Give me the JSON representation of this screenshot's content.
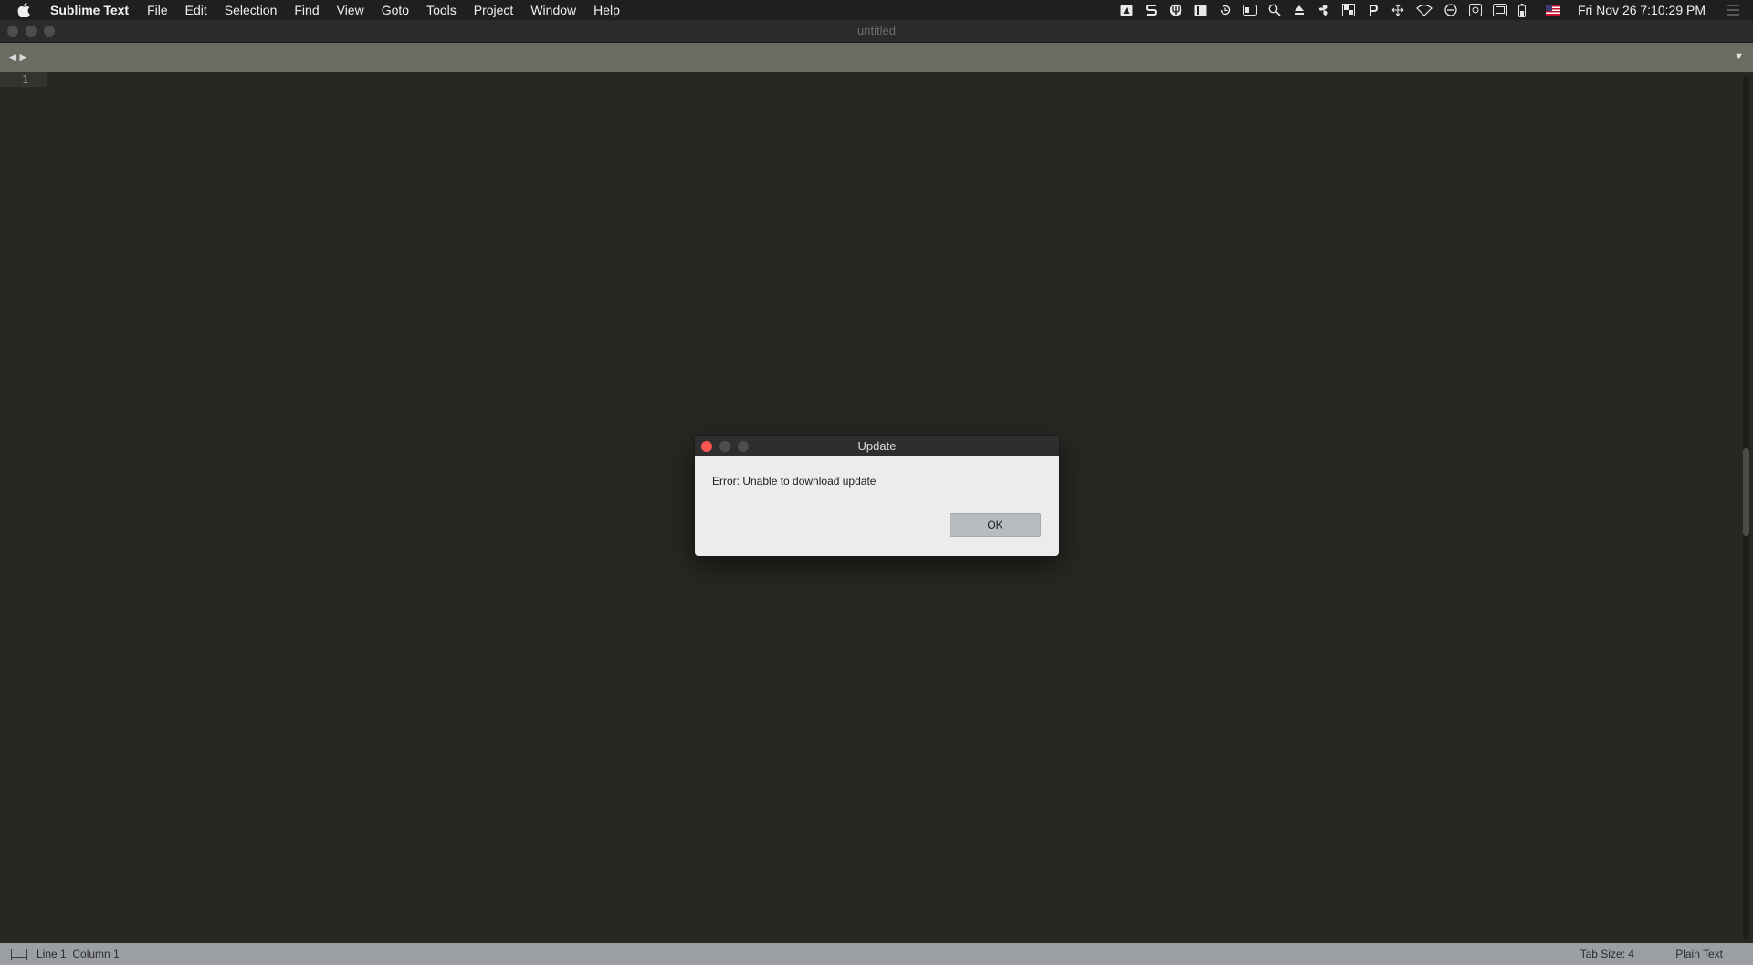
{
  "menubar": {
    "app_name": "Sublime Text",
    "items": [
      "File",
      "Edit",
      "Selection",
      "Find",
      "View",
      "Goto",
      "Tools",
      "Project",
      "Window",
      "Help"
    ],
    "clock": "Fri Nov 26  7:10:29 PM",
    "tray_icons": [
      "drive-icon",
      "s-app-icon",
      "fork-icon",
      "sidebar-icon",
      "history-icon",
      "display-icon",
      "spotlight-icon",
      "eject-icon",
      "fan-icon",
      "grid-icon",
      "p-app-icon",
      "move-icon",
      "wifi-icon",
      "do-not-disturb-icon",
      "screenshot-icon",
      "camera-icon",
      "battery-icon",
      "us-flag-icon"
    ]
  },
  "window": {
    "title": "untitled"
  },
  "editor": {
    "line_number": "1"
  },
  "statusbar": {
    "position": "Line 1, Column 1",
    "tab_size": "Tab Size: 4",
    "syntax": "Plain Text"
  },
  "dialog": {
    "title": "Update",
    "message": "Error: Unable to download update",
    "ok_label": "OK"
  },
  "colors": {
    "editor_bg": "#272822",
    "close_button": "#fc5652",
    "statusbar_bg": "#9b9ea3"
  }
}
